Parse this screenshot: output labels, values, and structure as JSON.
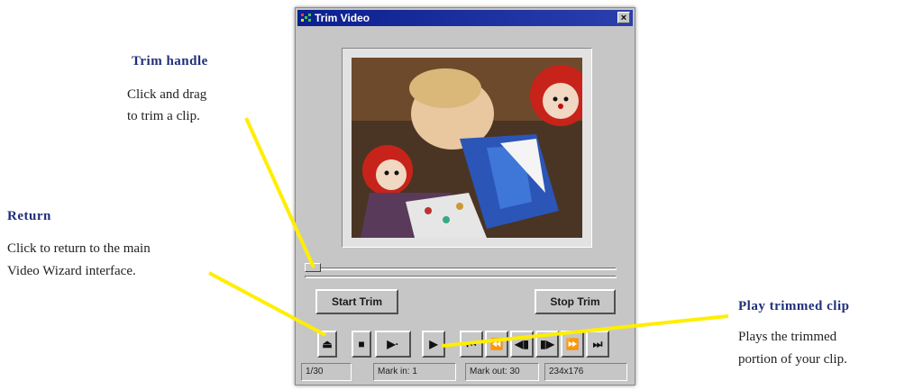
{
  "window": {
    "title": "Trim Video",
    "close_label": "×"
  },
  "buttons": {
    "start_trim": "Start Trim",
    "stop_trim": "Stop Trim"
  },
  "controls": [
    {
      "name": "return-button",
      "glyph": "⏏"
    },
    {
      "name": "stop-button",
      "glyph": "■"
    },
    {
      "name": "play-loop-button",
      "glyph": "▶·"
    },
    {
      "name": "play-trimmed-button",
      "glyph": "▶"
    },
    {
      "name": "go-to-start-button",
      "glyph": "⏮"
    },
    {
      "name": "rewind-button",
      "glyph": "⏪"
    },
    {
      "name": "step-back-button",
      "glyph": "◀▮"
    },
    {
      "name": "step-forward-button",
      "glyph": "▮▶"
    },
    {
      "name": "fast-forward-button",
      "glyph": "⏩"
    },
    {
      "name": "go-to-end-button",
      "glyph": "⏭"
    }
  ],
  "status": {
    "frame": "1/30",
    "mark_in": "Mark in: 1",
    "mark_out": "Mark out: 30",
    "size": "234x176"
  },
  "annotations": {
    "trim_handle": {
      "title": "Trim handle",
      "line1": "Click and drag",
      "line2": "to trim a clip."
    },
    "return": {
      "title": "Return",
      "line1": "Click to return to the main",
      "line2": "Video Wizard interface."
    },
    "play_trimmed": {
      "title": "Play trimmed clip",
      "line1": "Plays the trimmed",
      "line2": "portion of your clip."
    }
  },
  "colors": {
    "annotation_title": "#1f2f7a",
    "pointer": "#ffee00",
    "titlebar": "#0b1f8e"
  }
}
